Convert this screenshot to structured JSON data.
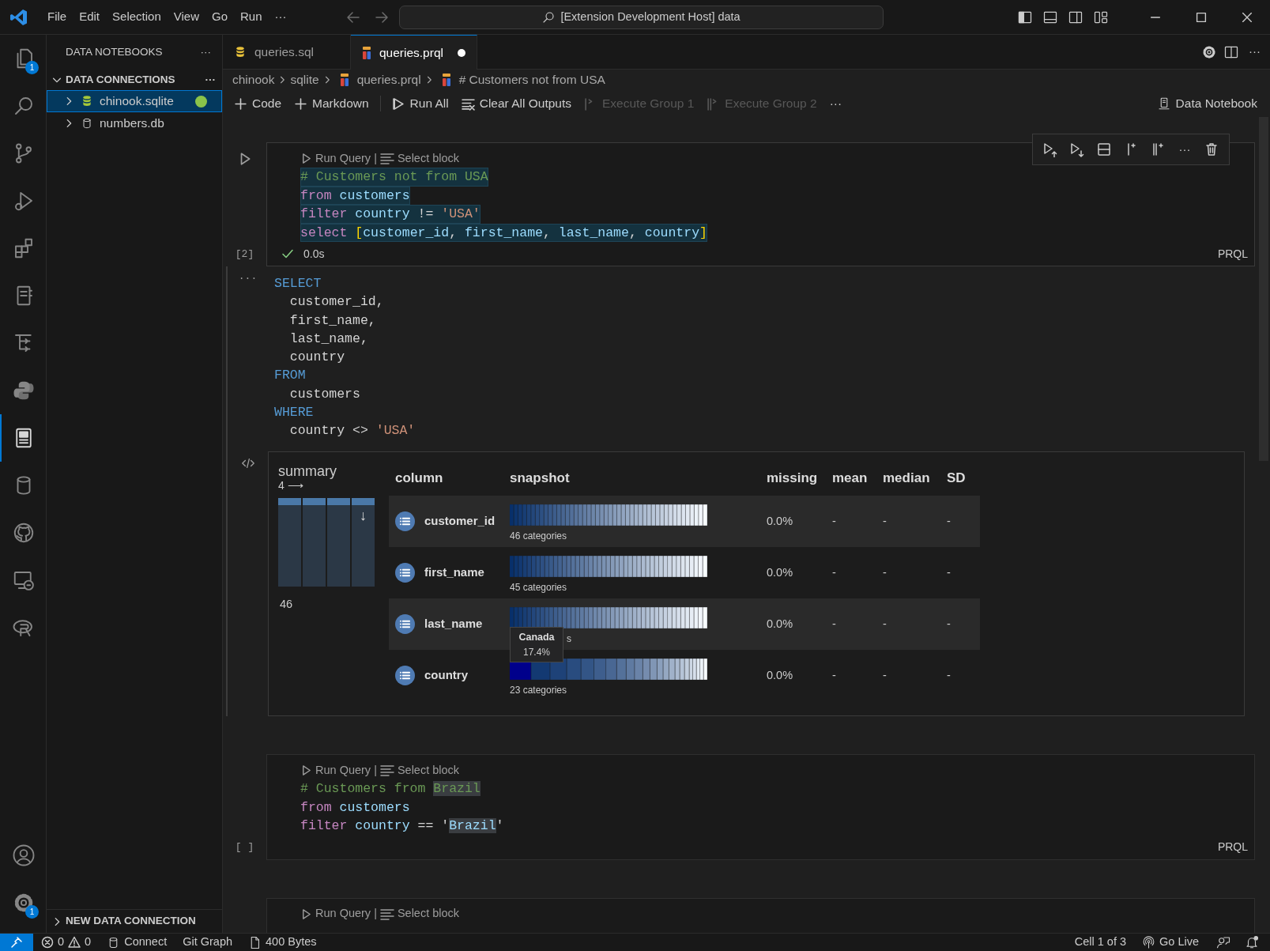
{
  "title_bar": {
    "menus": [
      "File",
      "Edit",
      "Selection",
      "View",
      "Go",
      "Run",
      "···"
    ],
    "command_center": "[Extension Development Host] data"
  },
  "activity_bar": {
    "items": [
      {
        "selected": false,
        "badge": "1"
      },
      {
        "selected": false
      },
      {
        "selected": false
      },
      {
        "selected": false
      },
      {
        "selected": false
      },
      {
        "selected": false
      },
      {
        "selected": false
      },
      {
        "selected": false
      },
      {
        "selected": true
      },
      {
        "selected": false
      },
      {
        "selected": false
      },
      {
        "selected": false
      },
      {
        "selected": false
      }
    ],
    "manage_badge": "1"
  },
  "sidebar": {
    "title": "DATA NOTEBOOKS",
    "more": "···",
    "section": {
      "title": "DATA CONNECTIONS",
      "more": "···",
      "expanded": true
    },
    "connections": [
      {
        "name": "chinook.sqlite",
        "selected": true,
        "connected": true,
        "expanded": false
      },
      {
        "name": "numbers.db",
        "selected": false,
        "connected": false,
        "expanded": false
      }
    ],
    "footer": {
      "title": "NEW DATA CONNECTION",
      "expanded": false
    }
  },
  "tabs": [
    {
      "label": "queries.sql",
      "kind": "sql",
      "selected": false,
      "dirty": false
    },
    {
      "label": "queries.prql",
      "kind": "prql",
      "selected": true,
      "dirty": true
    }
  ],
  "breadcrumb": [
    {
      "label": "chinook",
      "kind": "folder"
    },
    {
      "label": "sqlite",
      "kind": "folder"
    },
    {
      "label": "queries.prql",
      "kind": "prql"
    },
    {
      "label": "# Customers not from USA",
      "kind": "prql"
    }
  ],
  "toolbar": [
    {
      "label": "Code",
      "kind": "add",
      "disabled": false
    },
    {
      "label": "Markdown",
      "kind": "add",
      "disabled": false
    },
    {
      "kind": "separator"
    },
    {
      "label": "Run All",
      "kind": "run-all",
      "disabled": false
    },
    {
      "label": "Clear All Outputs",
      "kind": "clear",
      "disabled": false
    },
    {
      "label": "Execute Group 1",
      "kind": "group1",
      "disabled": true
    },
    {
      "label": "Execute Group 2",
      "kind": "group2",
      "disabled": true
    },
    {
      "label": "···",
      "kind": "more"
    }
  ],
  "editor_actions": {
    "more": "···"
  },
  "kernel": "Data Notebook",
  "cells": [
    {
      "focused": true,
      "toolbar_more": "···",
      "execution": "[2]",
      "succeeded": true,
      "time": "0.0s",
      "language": "PRQL",
      "codelens": [
        "Run Query",
        "|",
        "Select block"
      ],
      "lines": [
        {
          "highlighted": true,
          "tokens": [
            {
              "text": "# Customers not from USA",
              "kind": "comment"
            }
          ]
        },
        {
          "highlighted": true,
          "tokens": [
            {
              "text": "from",
              "kind": "keyword"
            },
            {
              "text": " customers",
              "kind": "name"
            }
          ]
        },
        {
          "highlighted": true,
          "tokens": [
            {
              "text": "filter",
              "kind": "keyword"
            },
            {
              "text": " country",
              "kind": "name"
            },
            {
              "text": " != ",
              "kind": "op"
            },
            {
              "text": "'USA'",
              "kind": "string"
            }
          ]
        },
        {
          "highlighted": true,
          "tokens": [
            {
              "text": "select ",
              "kind": "keyword"
            },
            {
              "text": "[",
              "kind": "bracket"
            },
            {
              "text": "customer_id",
              "kind": "name"
            },
            {
              "text": ", ",
              "kind": "op"
            },
            {
              "text": "first_name",
              "kind": "name"
            },
            {
              "text": ", ",
              "kind": "op"
            },
            {
              "text": "last_name",
              "kind": "name"
            },
            {
              "text": ", ",
              "kind": "op"
            },
            {
              "text": "country",
              "kind": "name"
            },
            {
              "text": "]",
              "kind": "bracket"
            }
          ]
        }
      ],
      "output": {
        "menu": "···",
        "sql": [
          [
            {
              "text": "SELECT",
              "kind": "sql-keyword"
            }
          ],
          [
            {
              "text": "  customer_id,",
              "kind": "op"
            }
          ],
          [
            {
              "text": "  first_name,",
              "kind": "op"
            }
          ],
          [
            {
              "text": "  last_name,",
              "kind": "op"
            }
          ],
          [
            {
              "text": "  country",
              "kind": "op"
            }
          ],
          [
            {
              "text": "FROM",
              "kind": "sql-keyword"
            }
          ],
          [
            {
              "text": "  customers",
              "kind": "op"
            }
          ],
          [
            {
              "text": "WHERE",
              "kind": "sql-keyword"
            }
          ],
          [
            {
              "text": "  country <> ",
              "kind": "op"
            },
            {
              "text": "'USA'",
              "kind": "string"
            }
          ]
        ],
        "summary": {
          "title": "summary",
          "columns_label": "4 ⟶",
          "arrow": "↓",
          "rows_label": "46",
          "headers": [
            "column",
            "snapshot",
            "missing",
            "mean",
            "median",
            "SD"
          ],
          "rows": [
            {
              "name": "customer_id",
              "categories": "46 categories",
              "hovered": false,
              "missing": "0.0%",
              "mean": "-",
              "median": "-",
              "sd": "-"
            },
            {
              "name": "first_name",
              "categories": "45 categories",
              "hovered": false,
              "missing": "0.0%",
              "mean": "-",
              "median": "-",
              "sd": "-"
            },
            {
              "name": "last_name",
              "categories": "s",
              "hovered": false,
              "missing": "0.0%",
              "mean": "-",
              "median": "-",
              "sd": "-"
            },
            {
              "name": "country",
              "categories": "23 categories",
              "hovered": true,
              "missing": "0.0%",
              "mean": "-",
              "median": "-",
              "sd": "-"
            }
          ],
          "tooltip": {
            "title": "Canada",
            "value": "17.4%"
          }
        }
      }
    },
    {
      "focused": false,
      "execution": "[ ]",
      "succeeded": false,
      "language": "PRQL",
      "codelens": [
        "Run Query",
        "|",
        "Select block"
      ],
      "lines": [
        {
          "highlighted": false,
          "tokens": [
            {
              "text": "# Customers from ",
              "kind": "comment"
            },
            {
              "text": "Brazil",
              "kind": "comment-match"
            }
          ]
        },
        {
          "highlighted": false,
          "tokens": [
            {
              "text": "from",
              "kind": "keyword"
            },
            {
              "text": " customers",
              "kind": "name"
            }
          ]
        },
        {
          "highlighted": false,
          "tokens": [
            {
              "text": "filter",
              "kind": "keyword"
            },
            {
              "text": " country",
              "kind": "name"
            },
            {
              "text": " == '",
              "kind": "op"
            },
            {
              "text": "Brazil",
              "kind": "name-match"
            },
            {
              "text": "'",
              "kind": "op"
            }
          ]
        }
      ]
    },
    {
      "focused": false,
      "codelens": [
        "Run Query",
        "|",
        "Select block"
      ]
    }
  ],
  "status_bar": {
    "errors": "0",
    "warnings": "0",
    "left": [
      {
        "label": "Connect",
        "kind": "database"
      },
      {
        "label": "Git Graph",
        "kind": "text"
      },
      {
        "label": "400 Bytes",
        "kind": "file"
      }
    ],
    "right": [
      {
        "label": "Cell 1 of 3",
        "kind": "text"
      },
      {
        "label": "Go Live",
        "kind": "broadcast"
      }
    ]
  }
}
